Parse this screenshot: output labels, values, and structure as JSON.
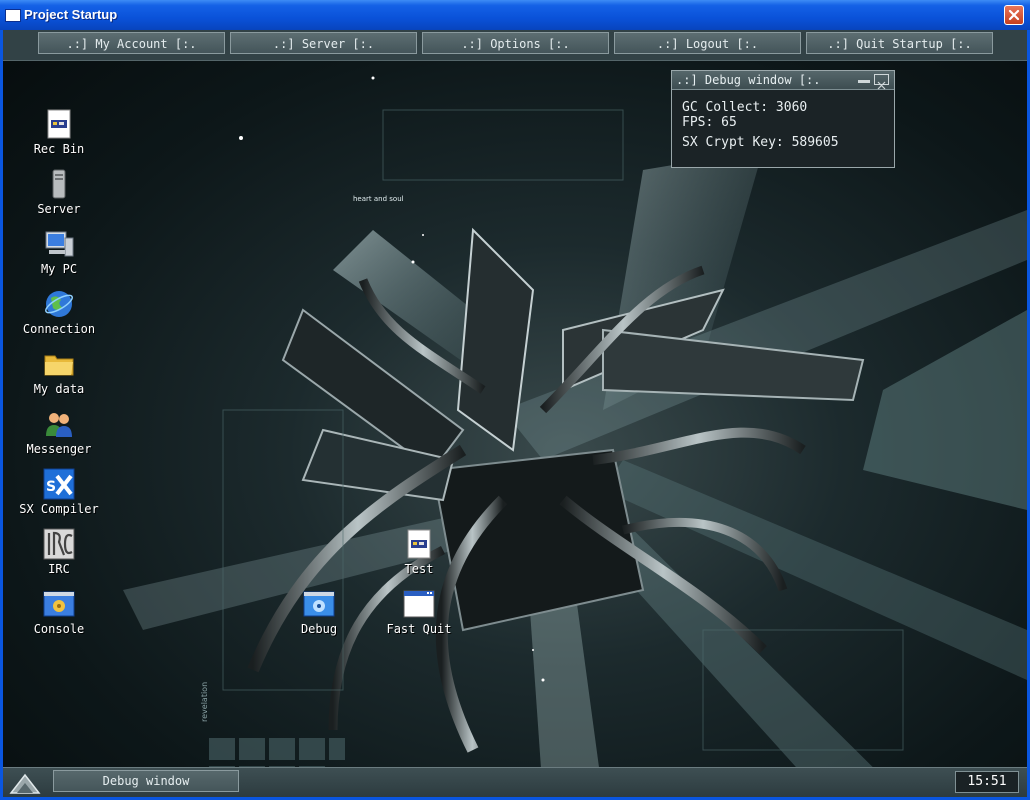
{
  "window": {
    "title": "Project Startup"
  },
  "menu": {
    "items": [
      {
        "label": ".:] My Account [:."
      },
      {
        "label": ".:] Server [:."
      },
      {
        "label": ".:] Options [:."
      },
      {
        "label": ".:] Logout [:."
      },
      {
        "label": ".:] Quit Startup [:."
      }
    ]
  },
  "wallpaper": {
    "text1": "heart and soul",
    "text2": "revelation"
  },
  "desktop": {
    "icons": [
      {
        "label": "Rec Bin",
        "icon": "recycle-bin-icon"
      },
      {
        "label": "Server",
        "icon": "server-icon"
      },
      {
        "label": "My PC",
        "icon": "computer-icon"
      },
      {
        "label": "Connection",
        "icon": "globe-icon"
      },
      {
        "label": "My data",
        "icon": "folder-icon"
      },
      {
        "label": "Messenger",
        "icon": "messenger-icon"
      },
      {
        "label": "SX Compiler",
        "icon": "sx-compiler-icon"
      },
      {
        "label": "IRC",
        "icon": "irc-icon"
      },
      {
        "label": "Console",
        "icon": "console-icon"
      },
      {
        "label": "Test",
        "icon": "document-icon"
      },
      {
        "label": "Debug",
        "icon": "debug-icon"
      },
      {
        "label": "Fast Quit",
        "icon": "window-icon"
      }
    ]
  },
  "debug_window": {
    "title": ".:] Debug window [:.",
    "gc_collect": "GC Collect: 3060",
    "fps": "FPS: 65",
    "crypt_key": "SX Crypt Key: 589605"
  },
  "taskbar": {
    "task": "Debug window",
    "clock": "15:51"
  },
  "colors": {
    "titlebar": "#0a52d9",
    "menubar": "#324246",
    "close_button": "#c63f1f"
  }
}
